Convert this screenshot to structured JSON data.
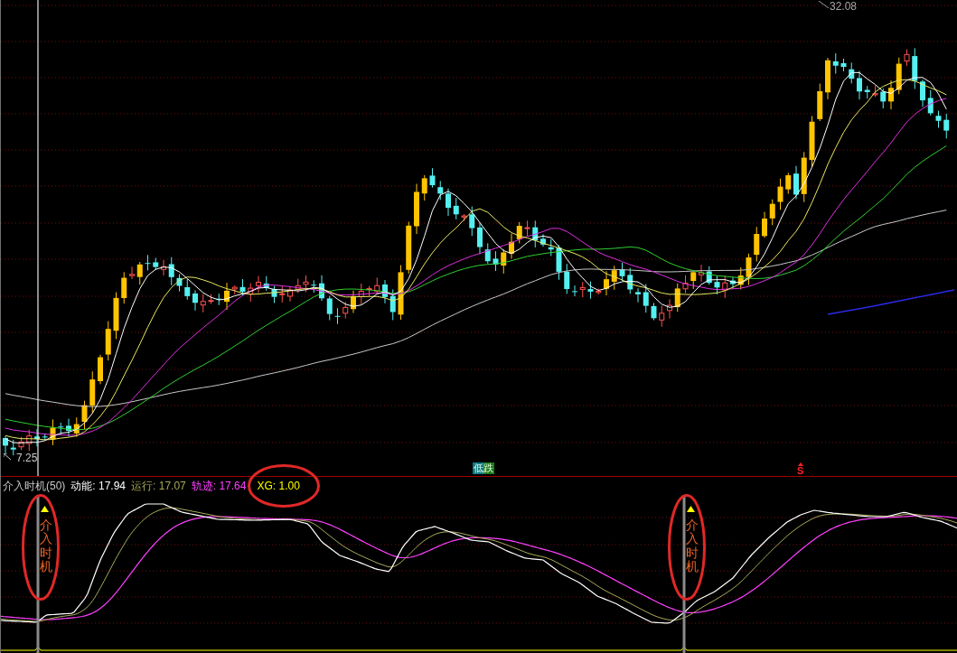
{
  "price_chart": {
    "high_label": "32.08",
    "low_label": "7.25",
    "markers": [
      {
        "kind": "tag",
        "text": "低跌"
      },
      {
        "kind": "signal",
        "text": "S"
      }
    ]
  },
  "indicator": {
    "title": "介入时机(50)",
    "readings": [
      {
        "text": "动能: 17.94",
        "color": "#ffffff"
      },
      {
        "text": "运行: 17.07",
        "color": "#a8a858"
      },
      {
        "text": "轨迹: 17.64",
        "color": "#ff40ff"
      },
      {
        "text": "XG: 1.00",
        "color": "#ffff00"
      }
    ],
    "signals": [
      {
        "text": "介入时机"
      },
      {
        "text": "介入时机"
      }
    ]
  }
}
